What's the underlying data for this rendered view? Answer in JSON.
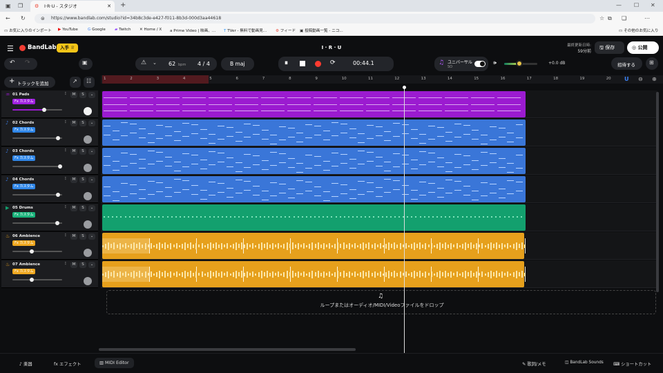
{
  "browser": {
    "tab_title": "I·R·U - スタジオ",
    "url": "https://www.bandlab.com/studio?id=34b8c3de-e427-f011-8b3d-000d3aa44618",
    "bookmarks": [
      "お気に入りのインポート",
      "YouTube",
      "Google",
      "Twitch",
      "Home / X",
      "Prime Video | 映画、...",
      "TVer - 無料で動画見...",
      "フィード",
      "投稿動画一覧 - ニコ..."
    ],
    "other_bookmarks": "その他のお気に入り"
  },
  "app": {
    "logo": "BandLab",
    "join_label": "入手",
    "project_title": "I · R · U",
    "last_update_label": "最終更新日時:",
    "last_update_value": "59分前",
    "save_label": "保存",
    "public_label": "公開",
    "invite_label": "招待する",
    "bpm_value": "62",
    "bpm_unit": "bpm",
    "time_signature": "4 / 4",
    "key": "B maj",
    "time_display": "00:44.1",
    "universal_label": "ユニバーサル",
    "universal_sub": "SO",
    "volume_db": "+0.0 dB",
    "volume_level": 0.45,
    "add_track_label": "トラックを追加",
    "drop_zone_text": "ループまたはオーディオ/MIDI/Videoファイルをドロップ"
  },
  "ruler": [
    "1",
    "2",
    "3",
    "4",
    "5",
    "6",
    "7",
    "8",
    "9",
    "10",
    "11",
    "12",
    "13",
    "14",
    "15",
    "16",
    "17",
    "18",
    "19",
    "20"
  ],
  "tracks": [
    {
      "name": "01  Pads",
      "fx": "カスタム",
      "fx_prefix": "Fx",
      "color": "#9b1bd0",
      "fxcolor": "#a020e0",
      "mute": "M",
      "solo": "S",
      "volume": 0.65
    },
    {
      "name": "02  Chords",
      "fx": "カスタム",
      "fx_prefix": "Fx",
      "color": "#3a76d8",
      "fxcolor": "#2f86e8",
      "mute": "M",
      "solo": "S",
      "volume": 0.96
    },
    {
      "name": "03  Chords",
      "fx": "カスタム",
      "fx_prefix": "Fx",
      "color": "#3a76d8",
      "fxcolor": "#2f86e8",
      "mute": "M",
      "solo": "S",
      "volume": 1.0
    },
    {
      "name": "04  Chords",
      "fx": "カスタム",
      "fx_prefix": "Fx",
      "color": "#3a76d8",
      "fxcolor": "#2f86e8",
      "mute": "M",
      "solo": "S",
      "volume": 0.96
    },
    {
      "name": "05  Drums",
      "fx": "カスタム",
      "fx_prefix": "Fx",
      "color": "#13a06e",
      "fxcolor": "#18b27a",
      "mute": "M",
      "solo": "S",
      "volume": 0.94
    },
    {
      "name": "06  Ambience",
      "fx": "カスタム",
      "fx_prefix": "Fx",
      "color": "#e6a01c",
      "fxcolor": "#f0a81f",
      "mute": "M",
      "solo": "S",
      "volume": 0.38
    },
    {
      "name": "07  Ambience",
      "fx": "カスタム",
      "fx_prefix": "Fx",
      "color": "#e6a01c",
      "fxcolor": "#f0a81f",
      "mute": "M",
      "solo": "S",
      "volume": 0.38
    }
  ],
  "footer": {
    "instrument": "楽器",
    "effects": "エフェクト",
    "midi_editor": "MIDI Editor",
    "lyrics": "歌詞/メモ",
    "sounds": "BandLab Sounds",
    "shortcuts": "ショートカット"
  }
}
